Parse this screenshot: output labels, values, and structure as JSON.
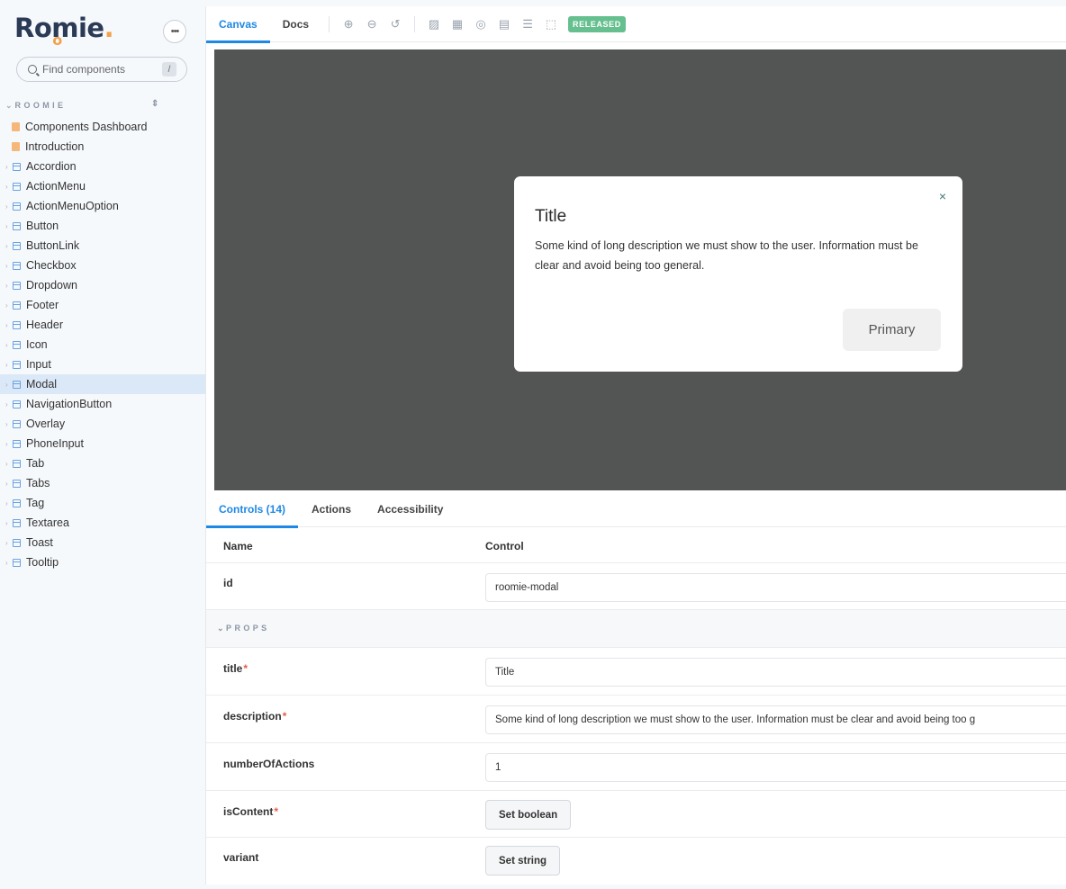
{
  "app": {
    "logo_text": "Roomie",
    "search": {
      "placeholder": "Find components",
      "shortcut": "/"
    },
    "section_title": "ROOMIE"
  },
  "sidebar": {
    "items": [
      {
        "label": "Components Dashboard",
        "type": "doc"
      },
      {
        "label": "Introduction",
        "type": "doc"
      },
      {
        "label": "Accordion",
        "type": "component"
      },
      {
        "label": "ActionMenu",
        "type": "component"
      },
      {
        "label": "ActionMenuOption",
        "type": "component"
      },
      {
        "label": "Button",
        "type": "component"
      },
      {
        "label": "ButtonLink",
        "type": "component"
      },
      {
        "label": "Checkbox",
        "type": "component"
      },
      {
        "label": "Dropdown",
        "type": "component"
      },
      {
        "label": "Footer",
        "type": "component"
      },
      {
        "label": "Header",
        "type": "component"
      },
      {
        "label": "Icon",
        "type": "component"
      },
      {
        "label": "Input",
        "type": "component"
      },
      {
        "label": "Modal",
        "type": "component",
        "active": true
      },
      {
        "label": "NavigationButton",
        "type": "component"
      },
      {
        "label": "Overlay",
        "type": "component"
      },
      {
        "label": "PhoneInput",
        "type": "component"
      },
      {
        "label": "Tab",
        "type": "component"
      },
      {
        "label": "Tabs",
        "type": "component"
      },
      {
        "label": "Tag",
        "type": "component"
      },
      {
        "label": "Textarea",
        "type": "component"
      },
      {
        "label": "Toast",
        "type": "component"
      },
      {
        "label": "Tooltip",
        "type": "component"
      }
    ]
  },
  "toolbar": {
    "tabs": {
      "canvas": "Canvas",
      "docs": "Docs"
    },
    "badge": "RELEASED",
    "icons": [
      "zoom-in-icon",
      "zoom-out-icon",
      "zoom-reset-icon",
      "background-icon",
      "grid-icon",
      "vision-icon",
      "viewport-icon",
      "outline-icon",
      "measure-icon"
    ]
  },
  "preview": {
    "modal": {
      "title": "Title",
      "description": "Some kind of long description we must show to the user. Information must be clear and avoid being too general.",
      "primary_label": "Primary",
      "close_glyph": "×"
    }
  },
  "addons": {
    "tabs": {
      "controls": "Controls (14)",
      "actions": "Actions",
      "accessibility": "Accessibility"
    },
    "table": {
      "col_name": "Name",
      "col_control": "Control",
      "id_label": "id",
      "id_value": "roomie-modal",
      "props_label": "PROPS",
      "rows": {
        "title": {
          "label": "title",
          "value": "Title"
        },
        "description": {
          "label": "description",
          "value": "Some kind of long description we must show to the user. Information must be clear and avoid being too g"
        },
        "numberOfActions": {
          "label": "numberOfActions",
          "value": "1"
        },
        "isContent": {
          "label": "isContent",
          "button": "Set boolean"
        },
        "variant": {
          "label": "variant",
          "button": "Set string"
        }
      },
      "required_mark": "*"
    }
  },
  "colors": {
    "accent": "#1e88e5",
    "badge": "#66bf8f",
    "canvas_bg": "#525553",
    "required": "#e25d4a"
  }
}
